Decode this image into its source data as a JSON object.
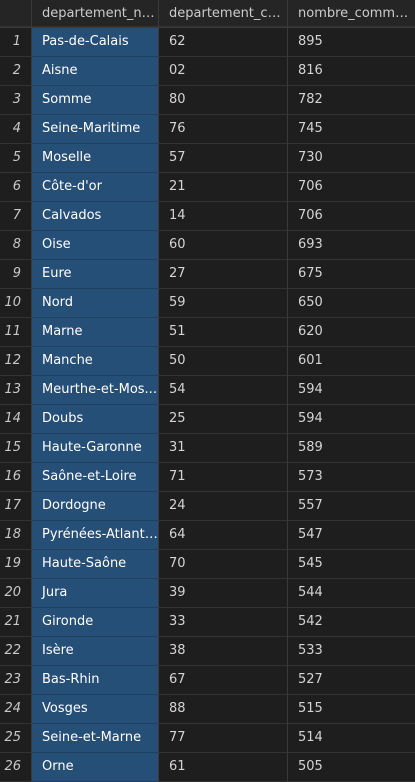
{
  "table": {
    "columns": [
      "",
      "departement_nom",
      "departement_code",
      "nombre_commune"
    ],
    "rows": [
      {
        "index": "1",
        "nom": "Pas-de-Calais",
        "code": "62",
        "nombre": "895"
      },
      {
        "index": "2",
        "nom": "Aisne",
        "code": "02",
        "nombre": "816"
      },
      {
        "index": "3",
        "nom": "Somme",
        "code": "80",
        "nombre": "782"
      },
      {
        "index": "4",
        "nom": "Seine-Maritime",
        "code": "76",
        "nombre": "745"
      },
      {
        "index": "5",
        "nom": "Moselle",
        "code": "57",
        "nombre": "730"
      },
      {
        "index": "6",
        "nom": "Côte-d'or",
        "code": "21",
        "nombre": "706"
      },
      {
        "index": "7",
        "nom": "Calvados",
        "code": "14",
        "nombre": "706"
      },
      {
        "index": "8",
        "nom": "Oise",
        "code": "60",
        "nombre": "693"
      },
      {
        "index": "9",
        "nom": "Eure",
        "code": "27",
        "nombre": "675"
      },
      {
        "index": "10",
        "nom": "Nord",
        "code": "59",
        "nombre": "650"
      },
      {
        "index": "11",
        "nom": "Marne",
        "code": "51",
        "nombre": "620"
      },
      {
        "index": "12",
        "nom": "Manche",
        "code": "50",
        "nombre": "601"
      },
      {
        "index": "13",
        "nom": "Meurthe-et-Mos...",
        "code": "54",
        "nombre": "594"
      },
      {
        "index": "14",
        "nom": "Doubs",
        "code": "25",
        "nombre": "594"
      },
      {
        "index": "15",
        "nom": "Haute-Garonne",
        "code": "31",
        "nombre": "589"
      },
      {
        "index": "16",
        "nom": "Saône-et-Loire",
        "code": "71",
        "nombre": "573"
      },
      {
        "index": "17",
        "nom": "Dordogne",
        "code": "24",
        "nombre": "557"
      },
      {
        "index": "18",
        "nom": "Pyrénées-Atlanti...",
        "code": "64",
        "nombre": "547"
      },
      {
        "index": "19",
        "nom": "Haute-Saône",
        "code": "70",
        "nombre": "545"
      },
      {
        "index": "20",
        "nom": "Jura",
        "code": "39",
        "nombre": "544"
      },
      {
        "index": "21",
        "nom": "Gironde",
        "code": "33",
        "nombre": "542"
      },
      {
        "index": "22",
        "nom": "Isère",
        "code": "38",
        "nombre": "533"
      },
      {
        "index": "23",
        "nom": "Bas-Rhin",
        "code": "67",
        "nombre": "527"
      },
      {
        "index": "24",
        "nom": "Vosges",
        "code": "88",
        "nombre": "515"
      },
      {
        "index": "25",
        "nom": "Seine-et-Marne",
        "code": "77",
        "nombre": "514"
      },
      {
        "index": "26",
        "nom": "Orne",
        "code": "61",
        "nombre": "505"
      }
    ]
  },
  "colors": {
    "background": "#1e1e1e",
    "header": "#252526",
    "selection": "#264f78",
    "grid_line": "#3a3a3a"
  }
}
